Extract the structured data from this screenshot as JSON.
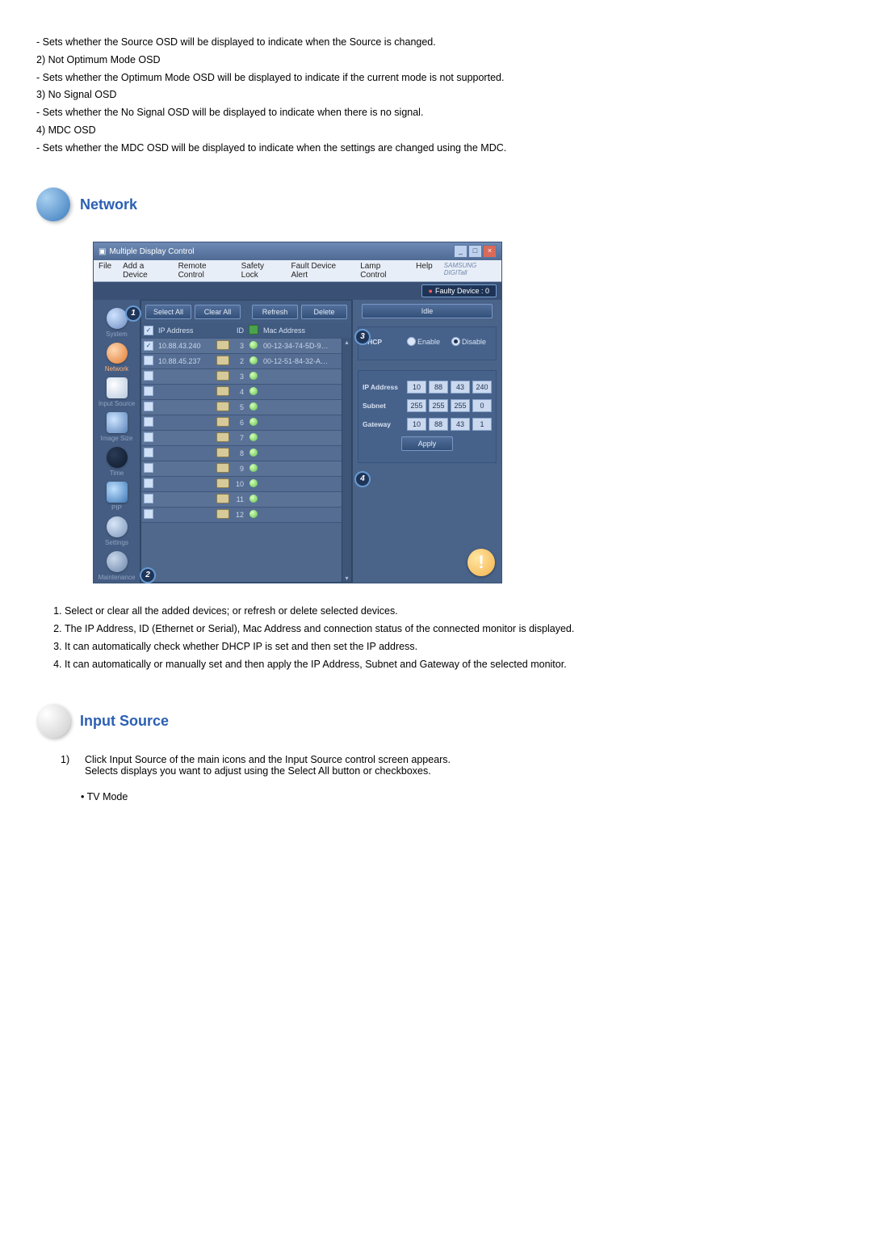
{
  "intro": {
    "i1": "- Sets whether the Source OSD will be displayed to indicate when the Source is changed.",
    "h2": "2) Not Optimum Mode OSD",
    "i2": "- Sets whether the Optimum Mode OSD will be displayed to indicate if the current mode is not supported.",
    "h3": "3) No Signal OSD",
    "i3": "- Sets whether the No Signal OSD will be displayed to indicate when there is no signal.",
    "h4": "4) MDC OSD",
    "i4": "- Sets whether the MDC OSD will be displayed to indicate when the settings are changed using the MDC."
  },
  "section_network": "Network",
  "section_inputsource": "Input Source",
  "mdc": {
    "title": "Multiple Display Control",
    "menu": [
      "File",
      "Add a Device",
      "Remote Control",
      "Safety Lock",
      "Fault Device Alert",
      "Lamp Control",
      "Help"
    ],
    "brand": "SAMSUNG DIGITall",
    "faulty": "Faulty Device : 0",
    "toolbar": {
      "select_all": "Select All",
      "clear_all": "Clear All",
      "refresh": "Refresh",
      "delete": "Delete"
    },
    "idle": "Idle",
    "sidebar": [
      "System",
      "Network",
      "Input Source",
      "Image Size",
      "Time",
      "PIP",
      "Settings",
      "Maintenance"
    ],
    "grid_head": {
      "ip": "IP Address",
      "id": "ID",
      "mac": "Mac Address"
    },
    "rows": [
      {
        "chk": true,
        "ip": "10.88.43.240",
        "id": "3",
        "mac": "00-12-34-74-5D-9…"
      },
      {
        "chk": false,
        "ip": "10.88.45.237",
        "id": "2",
        "mac": "00-12-51-84-32-A…"
      },
      {
        "chk": false,
        "ip": "",
        "id": "3",
        "mac": ""
      },
      {
        "chk": false,
        "ip": "",
        "id": "4",
        "mac": ""
      },
      {
        "chk": false,
        "ip": "",
        "id": "5",
        "mac": ""
      },
      {
        "chk": false,
        "ip": "",
        "id": "6",
        "mac": ""
      },
      {
        "chk": false,
        "ip": "",
        "id": "7",
        "mac": ""
      },
      {
        "chk": false,
        "ip": "",
        "id": "8",
        "mac": ""
      },
      {
        "chk": false,
        "ip": "",
        "id": "9",
        "mac": ""
      },
      {
        "chk": false,
        "ip": "",
        "id": "10",
        "mac": ""
      },
      {
        "chk": false,
        "ip": "",
        "id": "11",
        "mac": ""
      },
      {
        "chk": false,
        "ip": "",
        "id": "12",
        "mac": ""
      }
    ],
    "panel": {
      "dhcp_lbl": "DHCP",
      "enable": "Enable",
      "disable": "Disable",
      "ip_lbl": "IP Address",
      "ip": [
        "10",
        "88",
        "43",
        "240"
      ],
      "subnet_lbl": "Subnet",
      "subnet": [
        "255",
        "255",
        "255",
        "0"
      ],
      "gateway_lbl": "Gateway",
      "gateway": [
        "10",
        "88",
        "43",
        "1"
      ],
      "apply": "Apply"
    }
  },
  "callouts": {
    "c1": "1",
    "c2": "2",
    "c3": "3",
    "c4": "4"
  },
  "legend": [
    "Select or clear all the added devices; or refresh or delete selected devices.",
    "The IP Address, ID (Ethernet or Serial), Mac Address and connection status of the connected monitor is displayed.",
    "It can automatically check whether DHCP IP is set and then set the IP address.",
    "It can automatically or manually set and then apply the IP Address, Subnet and Gateway of the selected monitor."
  ],
  "inputsource": {
    "num": "1)",
    "l1": "Click Input Source of the main icons and the Input Source control screen appears.",
    "l2": "Selects displays you want to adjust using the Select All button or checkboxes.",
    "bullet": "• TV Mode"
  }
}
